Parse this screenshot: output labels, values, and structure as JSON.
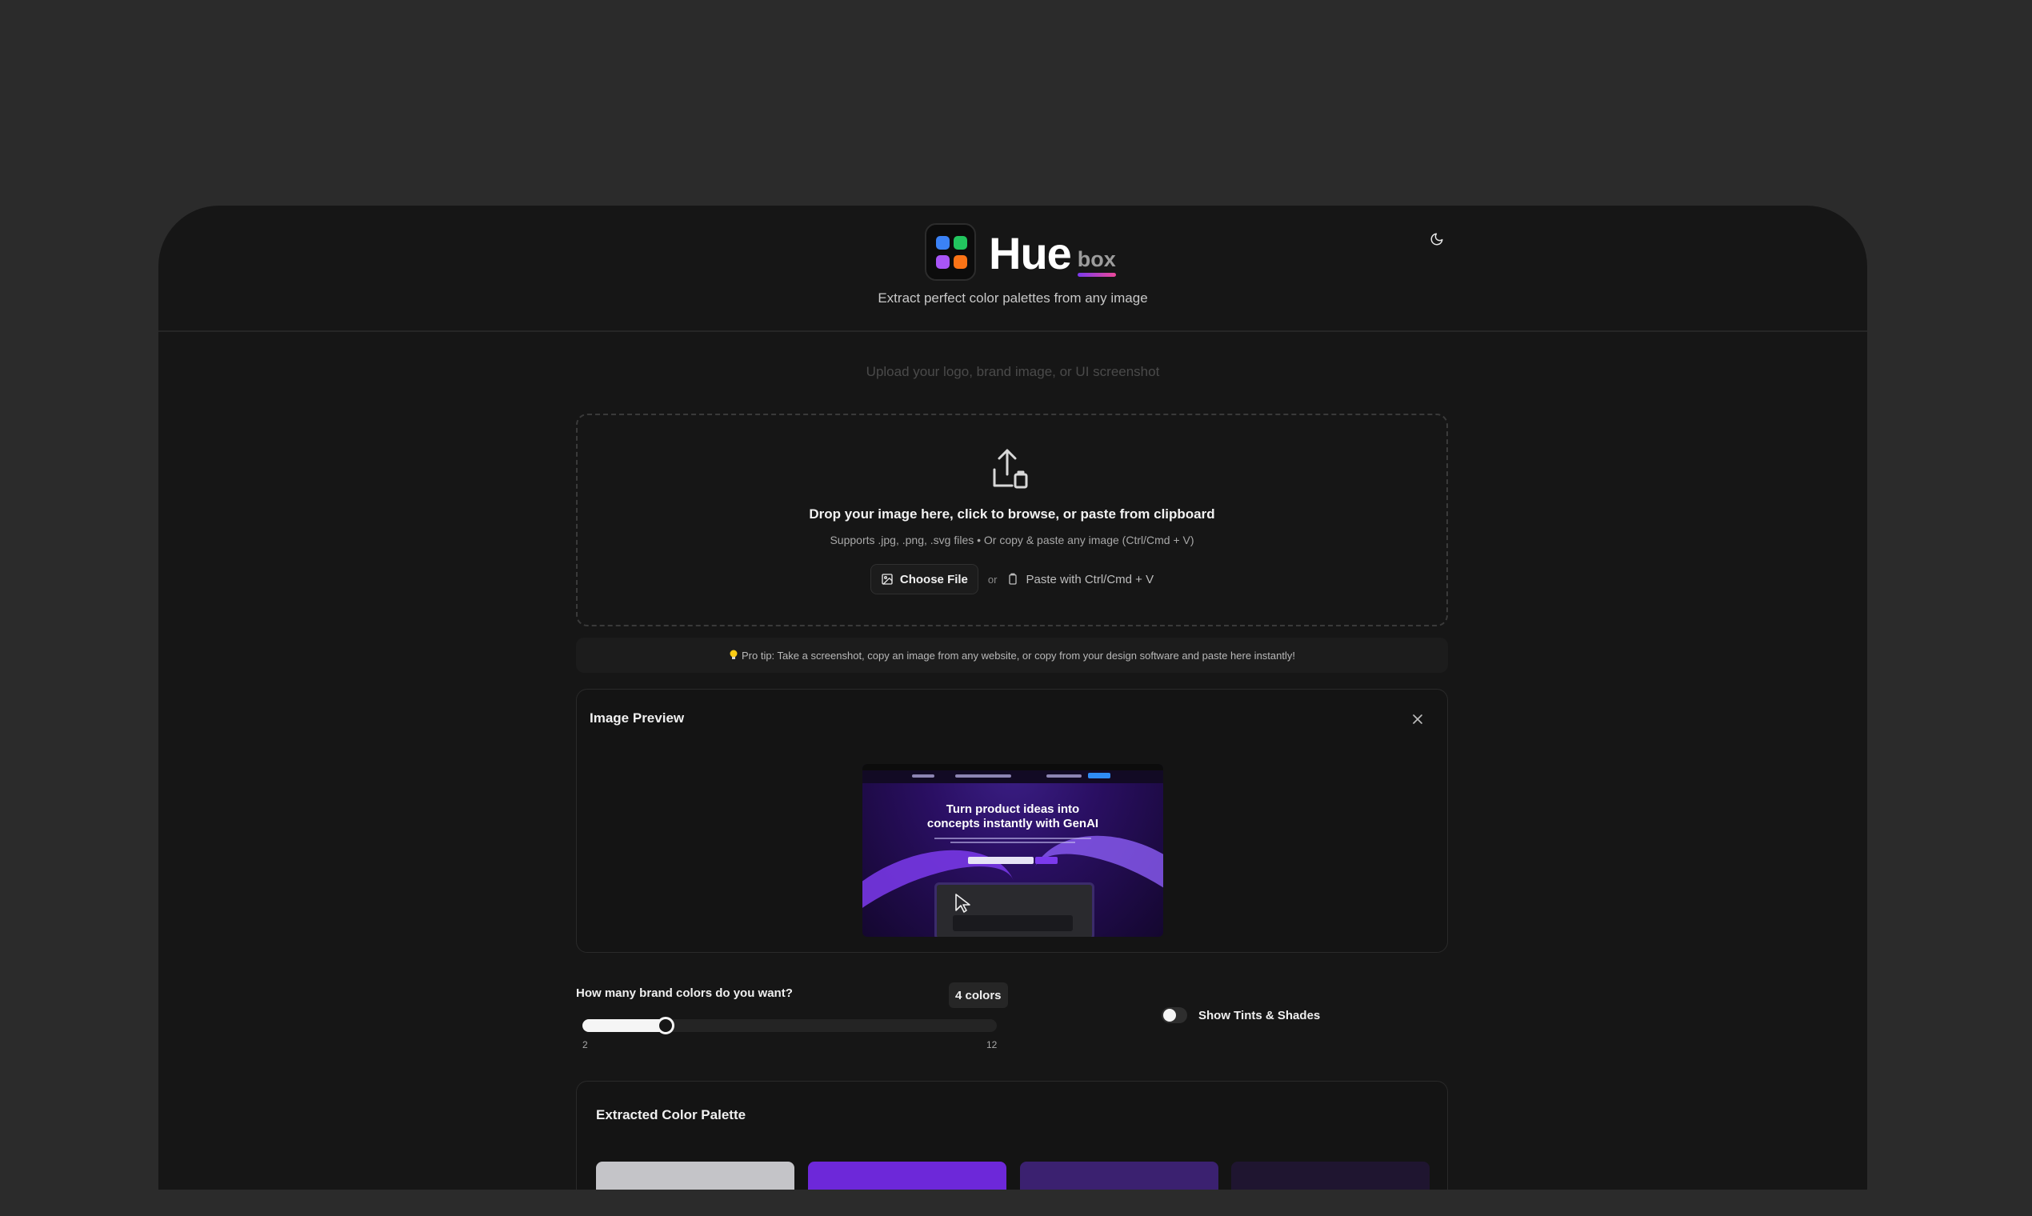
{
  "header": {
    "brand_main": "Hue",
    "brand_sub": "box",
    "tagline": "Extract perfect color palettes from any image",
    "logo_colors": [
      "#3b82f6",
      "#22c55e",
      "#a855f7",
      "#f97316"
    ],
    "theme_icon": "moon-icon"
  },
  "upload": {
    "hint": "Upload your logo, brand image, or UI screenshot",
    "title": "Drop your image here, click to browse, or paste from clipboard",
    "subtitle": "Supports .jpg, .png, .svg files • Or copy & paste any image (Ctrl/Cmd + V)",
    "choose_file_label": "Choose File",
    "or_label": "or",
    "paste_label": "Paste with Ctrl/Cmd + V",
    "icon": "upload-icon"
  },
  "protip": {
    "icon": "lightbulb-icon",
    "text": "Pro tip: Take a screenshot, copy an image from any website, or copy from your design software and paste here instantly!"
  },
  "preview": {
    "title": "Image Preview",
    "close_icon": "close-icon",
    "image_heading_line1": "Turn product ideas into",
    "image_heading_line2": "concepts instantly with GenAI"
  },
  "controls": {
    "slider_label": "How many brand colors do you want?",
    "count_badge": "4 colors",
    "slider_min": "2",
    "slider_max": "12",
    "slider_min_value": 2,
    "slider_max_value": 12,
    "slider_value": 4,
    "tints_label": "Show Tints & Shades",
    "tints_enabled": false
  },
  "palette": {
    "title": "Extracted Color Palette",
    "swatches": [
      "#c4c4c8",
      "#6d28d9",
      "#3b2170",
      "#1f1530"
    ]
  },
  "colors": {
    "background": "#2b2b2b",
    "frame": "#161616",
    "accent_gradient_start": "#7c3aed",
    "accent_gradient_end": "#ec4899"
  }
}
